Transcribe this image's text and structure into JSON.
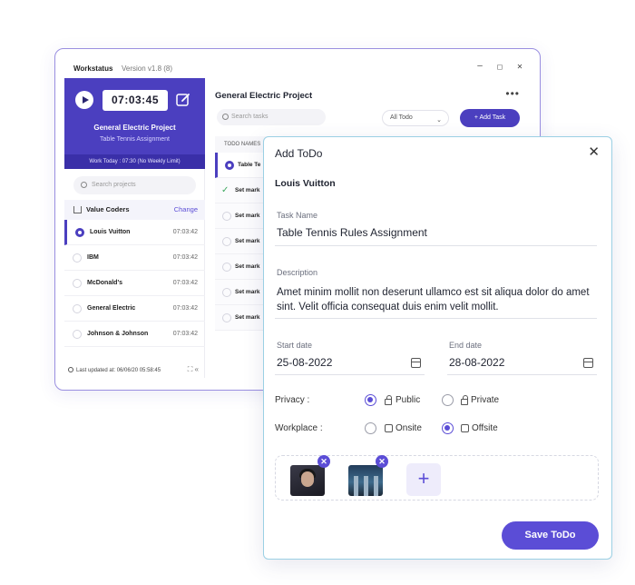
{
  "app": {
    "name": "Workstatus",
    "version": "Version v1.8 (8)",
    "window_controls": [
      "–",
      "◻",
      "✕"
    ]
  },
  "timer": {
    "time": "07:03:45",
    "project": "General Electric Project",
    "task": "Table Tennis Assignment",
    "work_today": "Work Today : 07:30 (No Weekly Limit)"
  },
  "sidebar": {
    "search_placeholder": "Search projects",
    "org_name": "Value Coders",
    "change_label": "Change",
    "projects": [
      {
        "name": "Louis Vuitton",
        "time": "07:03:42"
      },
      {
        "name": "IBM",
        "time": "07:03:42"
      },
      {
        "name": "McDonald's",
        "time": "07:03:42"
      },
      {
        "name": "General Electric",
        "time": "07:03:42"
      },
      {
        "name": "Johnson & Johnson",
        "time": "07:03:42"
      }
    ],
    "last_updated": "Last updated at: 06/06/20 05:58:45"
  },
  "main": {
    "project_title": "General Electric Project",
    "more": "•••",
    "search_placeholder": "Search tasks",
    "filter": "All Todo",
    "add_task": "+ Add Task",
    "todo_header": "TODO NAMES",
    "todos": [
      "Table Te",
      "Set mark",
      "Set mark",
      "Set mark",
      "Set mark",
      "Set mark",
      "Set mark"
    ]
  },
  "dialog": {
    "title": "Add ToDo",
    "close": "✕",
    "assignee": "Louis Vuitton",
    "task_name_label": "Task Name",
    "task_name_value": "Table Tennis Rules Assignment",
    "description_label": "Description",
    "description_value": "Amet minim mollit non deserunt ullamco est sit aliqua dolor do amet sint. Velit officia consequat duis enim velit mollit.",
    "start_date_label": "Start date",
    "start_date_value": "25-08-2022",
    "end_date_label": "End date",
    "end_date_value": "28-08-2022",
    "privacy_label": "Privacy :",
    "privacy_options": [
      "Public",
      "Private"
    ],
    "privacy_selected": "Public",
    "workplace_label": "Workplace :",
    "workplace_options": [
      "Onsite",
      "Offsite"
    ],
    "workplace_selected": "Offsite",
    "add_attachment": "+",
    "remove": "✕",
    "save_label": "Save ToDo"
  },
  "colors": {
    "accent": "#5b4dd6",
    "timer_bg": "#4b3fbf",
    "dialog_border": "#9bd0e4",
    "check_green": "#3ea85f"
  }
}
